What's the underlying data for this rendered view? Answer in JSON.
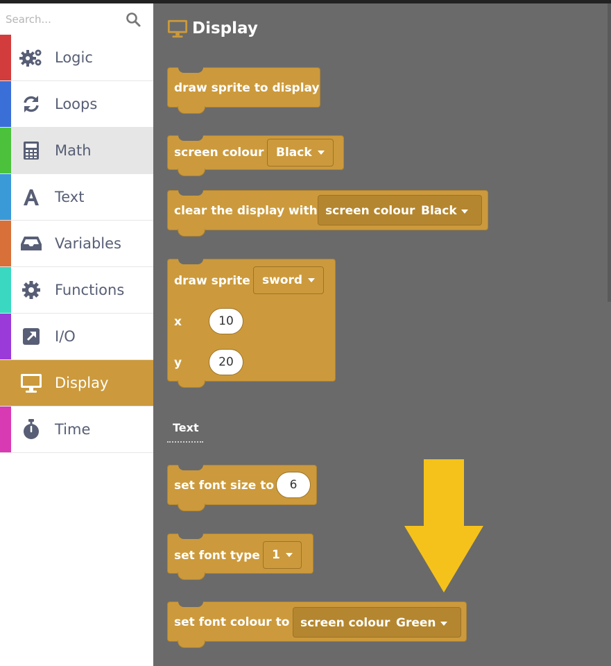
{
  "search": {
    "placeholder": "Search..."
  },
  "categories": [
    {
      "label": "Logic",
      "icon": "gears-icon",
      "color": "#d23c3c"
    },
    {
      "label": "Loops",
      "icon": "refresh-icon",
      "color": "#3a6fd8"
    },
    {
      "label": "Math",
      "icon": "calculator-icon",
      "color": "#4cc23c"
    },
    {
      "label": "Text",
      "icon": "text-a-icon",
      "color": "#3a9ad8"
    },
    {
      "label": "Variables",
      "icon": "inbox-icon",
      "color": "#d8703a"
    },
    {
      "label": "Functions",
      "icon": "gear-icon",
      "color": "#3ad8c0"
    },
    {
      "label": "I/O",
      "icon": "external-link-icon",
      "color": "#9a3ad8"
    },
    {
      "label": "Display",
      "icon": "monitor-icon",
      "color": "#cc9a3c"
    },
    {
      "label": "Time",
      "icon": "stopwatch-icon",
      "color": "#d83ab4"
    }
  ],
  "colors": {
    "block": "#cc9a3c",
    "workspace": "#6a6a6a",
    "arrow": "#f5c21c"
  },
  "flyout": {
    "title": "Display",
    "blocks": {
      "draw_sprite_display": "draw sprite to display",
      "screen_colour": {
        "label": "screen colour",
        "value": "Black"
      },
      "clear_display": {
        "label": "clear the display with",
        "inner_label": "screen colour",
        "inner_value": "Black"
      },
      "draw_sprite": {
        "label": "draw sprite",
        "sprite": "sword",
        "x_label": "x",
        "x_value": "10",
        "y_label": "y",
        "y_value": "20"
      }
    },
    "section": "Text",
    "text_blocks": {
      "font_size": {
        "label": "set font size to",
        "value": "6"
      },
      "font_type": {
        "label": "set font type",
        "value": "1"
      },
      "font_colour": {
        "label": "set font colour to",
        "inner_label": "screen colour",
        "inner_value": "Green"
      }
    }
  }
}
